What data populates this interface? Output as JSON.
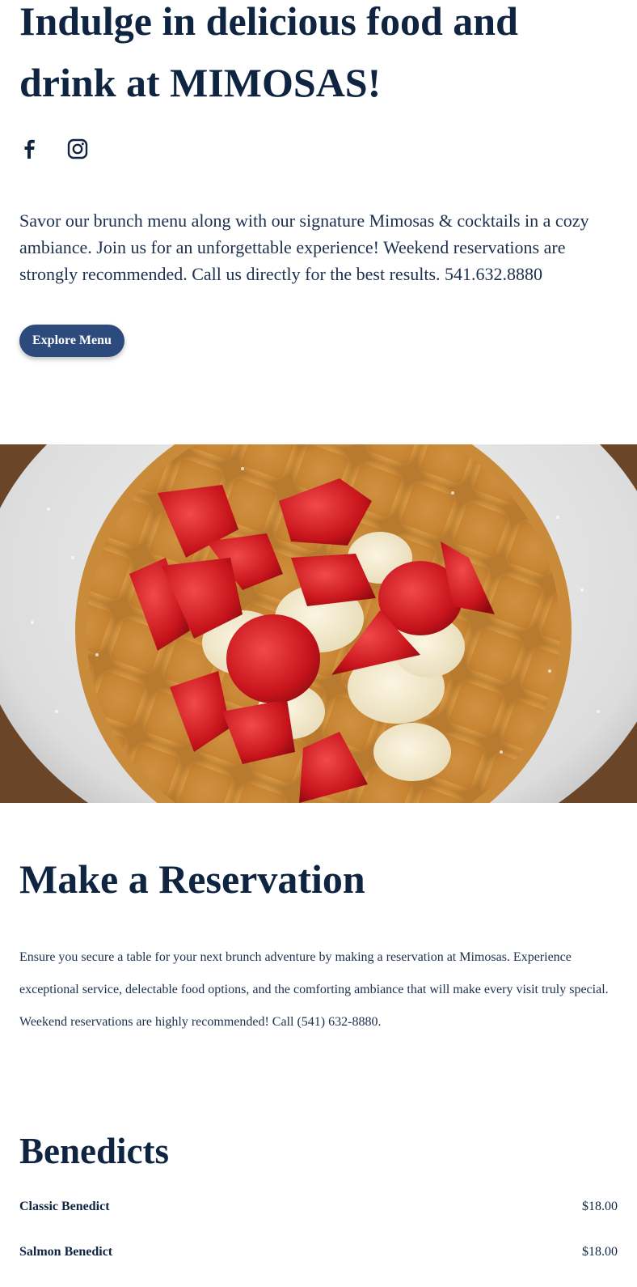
{
  "hero": {
    "title": "Indulge in delicious food and drink at MIMOSAS!",
    "intro": "Savor our brunch menu along with our signature Mimosas & cocktails in a cozy ambiance. Join us for an unforgettable experience! Weekend reservations are strongly recommended. Call us directly for the best results. 541.632.8880",
    "cta_label": "Explore Menu"
  },
  "social": [
    {
      "icon": "facebook-icon"
    },
    {
      "icon": "instagram-icon"
    }
  ],
  "hero_image": {
    "subject": "waffle with strawberries and bananas"
  },
  "reservation": {
    "title": "Make a Reservation",
    "text": "Ensure you secure a table for your next brunch adventure by making a reservation at Mimosas. Experience exceptional service, delectable food options, and the comforting ambiance that will make every visit truly special. Weekend reservations are highly recommended! Call (541) 632-8880."
  },
  "menu": {
    "section_title": "Benedicts",
    "items": [
      {
        "name": "Classic Benedict",
        "price": "$18.00"
      },
      {
        "name": "Salmon Benedict",
        "price": "$18.00"
      }
    ]
  },
  "colors": {
    "heading": "#0e2441",
    "button": "#2c4a7c"
  }
}
